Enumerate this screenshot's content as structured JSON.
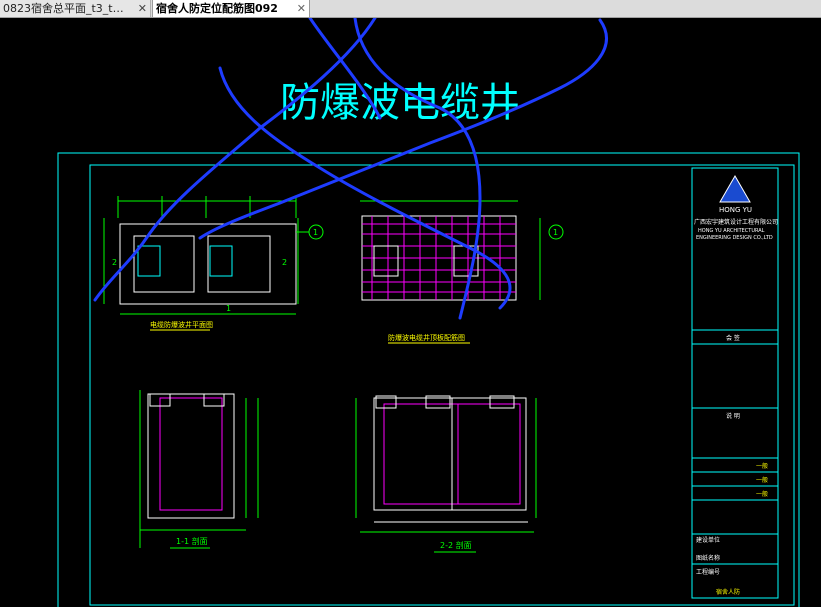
{
  "tabs": [
    {
      "label": "0823宿舍总平面_t3_t…",
      "close": "✕",
      "active": false
    },
    {
      "label": "宿舍人防定位配筋图092",
      "close": "✕",
      "active": true
    }
  ],
  "drawing": {
    "main_title": "防爆波电缆井",
    "plan_title_left": "电缆防爆波井平面图",
    "plan_title_right": "防爆波电缆井顶板配筋图",
    "section_title_left": "1-1 剖面",
    "section_title_right": "2-2 剖面",
    "grid_bubble": "1",
    "cut_mark_left": "2",
    "cut_mark_under": "1",
    "titleblock": {
      "logo_text": "HONG YU",
      "company_cn": "广西宏宇建筑设计工程有限公司",
      "company_en_1": "HONG YU ARCHITECTURAL",
      "company_en_2": "ENGINEERING DESIGN CO.,LTD",
      "revision_header": "会 签",
      "notes_header": "说 明",
      "approval_rows": [
        "一般",
        "一般",
        "一般"
      ],
      "project_label": "建设单位",
      "drawing_label": "图纸名称",
      "number_label": "工程编号",
      "sheet_label": "宿舍人防"
    }
  },
  "colors": {
    "frame": "#00ffff",
    "cad_text": "#00ffff",
    "sketch": "#1e3cff",
    "wall": "#ffffff",
    "rebar": "#ff00ff",
    "dim": "#00ff00",
    "rebar2": "#ff8cff",
    "title_yellow": "#ffff00"
  },
  "icons": {
    "tab_close": "close-icon",
    "logo": "triangle-logo-icon"
  }
}
